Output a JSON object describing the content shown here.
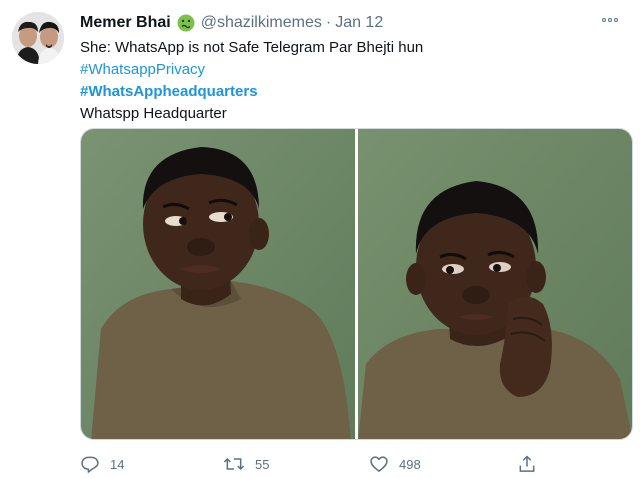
{
  "author": {
    "display_name": "Memer Bhai",
    "handle": "@shazilkimemes",
    "separator": "·",
    "date": "Jan 12",
    "badge_icon": "nauseated-face-emoji"
  },
  "tweet": {
    "line1": "She: WhatsApp is not Safe Telegram Par Bhejti hun",
    "hashtag1": "#WhatsappPrivacy",
    "hashtag2": "#WhatsAppheadquarters",
    "line4": "Whatspp Headquarter"
  },
  "media": {
    "count": 2,
    "photos": [
      {
        "subject": "boy-glancing-sideways"
      },
      {
        "subject": "boy-resting-chin-on-hand"
      }
    ]
  },
  "actions": {
    "replies": "14",
    "retweets": "55",
    "likes": "498",
    "reply_icon": "reply-icon",
    "retweet_icon": "retweet-icon",
    "like_icon": "heart-icon",
    "share_icon": "share-icon"
  },
  "colors": {
    "link": "#1b95e0",
    "muted": "#5b7083",
    "background": "#ffffff",
    "photo_wall": "#6f8a68"
  }
}
